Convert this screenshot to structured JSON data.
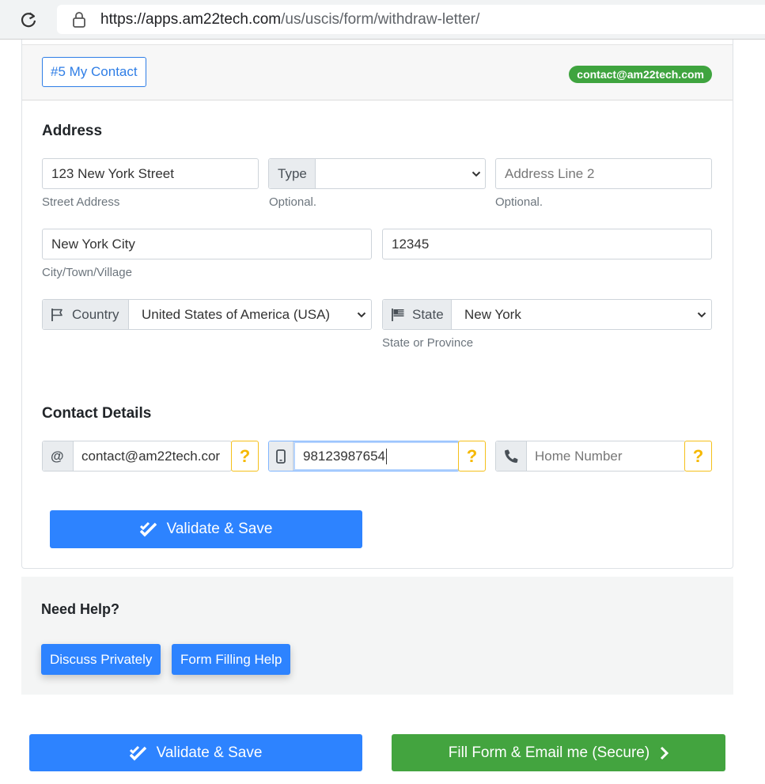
{
  "browser": {
    "url_host": "https://apps.am22tech.com",
    "url_path": "/us/uscis/form/withdraw-letter/"
  },
  "card": {
    "section_tag": "#5 My Contact",
    "email_badge": "contact@am22tech.com"
  },
  "address": {
    "heading": "Address",
    "street_value": "123 New York Street",
    "street_help": "Street Address",
    "type_label": "Type",
    "type_help": "Optional.",
    "line2_placeholder": "Address Line 2",
    "line2_help": "Optional.",
    "city_value": "New York City",
    "city_help": "City/Town/Village",
    "zip_value": "12345",
    "country_label": "Country",
    "country_value": "United States of America (USA)",
    "state_label": "State",
    "state_value": "New York",
    "state_help": "State or Province"
  },
  "contact": {
    "heading": "Contact Details",
    "email_symbol": "@",
    "email_value": "contact@am22tech.cor",
    "mobile_value": "98123987654",
    "home_placeholder": "Home Number",
    "help_mark": "?"
  },
  "actions": {
    "validate_label": "Validate & Save",
    "fill_email_label": "Fill Form & Email me (Secure)"
  },
  "help_panel": {
    "heading": "Need Help?",
    "discuss_label": "Discuss Privately",
    "form_help_label": "Form Filling Help"
  },
  "colors": {
    "primary": "#2d83ff",
    "success": "#43a43f",
    "warning": "#f5c01a"
  }
}
